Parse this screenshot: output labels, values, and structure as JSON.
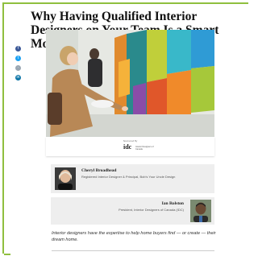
{
  "article": {
    "title": "Why Having Qualified Interior Designers on Your Team Is a Smart Move",
    "sponsor_label": "Sponsored By",
    "sponsor_logo": "idc",
    "sponsor_tag": "Interior Designers of Canada",
    "lede": "Interior designers have the expertise to help home buyers find — or create — their dream home."
  },
  "share": [
    {
      "icon": "facebook-icon",
      "color": "#3b5998"
    },
    {
      "icon": "twitter-icon",
      "color": "#1da1f2"
    },
    {
      "icon": "link-icon",
      "color": "#9aa7b3"
    },
    {
      "icon": "linkedin-icon",
      "color": "#0e76a8"
    }
  ],
  "authors": [
    {
      "name": "Cheryl Broadhead",
      "role": "Registered Interior Designer & Principal, Bob's Your Uncle Design"
    },
    {
      "name": "Ian Rolston",
      "role": "President, Interior Designers of Canada (IDC)"
    }
  ],
  "colors": {
    "frame": "#8fbf3f",
    "card": "#eeeeee"
  }
}
